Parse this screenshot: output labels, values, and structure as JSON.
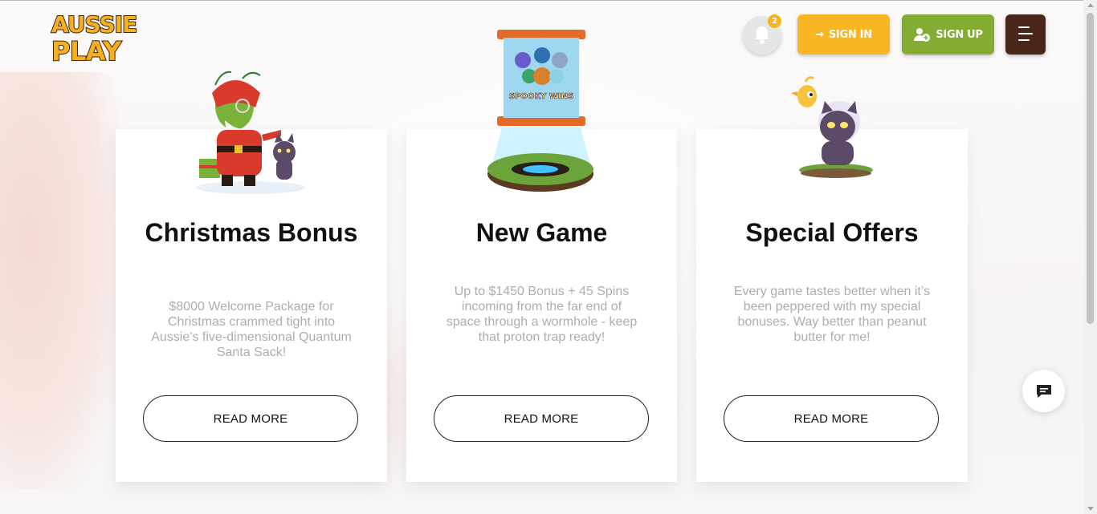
{
  "brand": {
    "logo_line1": "AUSSIE",
    "logo_line2": "PLAY"
  },
  "header": {
    "notifications_count": "2",
    "signin_label": "SIGN IN",
    "signup_label": "SIGN UP",
    "bell_icon": "bell-icon",
    "menu_icon": "hamburger-menu-icon"
  },
  "cards": [
    {
      "title": "Christmas Bonus",
      "text": "$8000 Welcome Package for Christmas crammed tight into Aussie’s five-dimensional Quantum Santa Sack!",
      "button": "READ MORE"
    },
    {
      "title": "New Game",
      "text": "Up to $1450 Bonus + 45 Spins incoming from the far end of space through a wormhole - keep that proton trap ready!",
      "button": "READ MORE",
      "game_logo": "SPOOKY WINS"
    },
    {
      "title": "Special Offers",
      "text": "Every game tastes better when it’s been peppered with my special bonuses. Way better than peanut butter for me!",
      "button": "READ MORE"
    }
  ],
  "colors": {
    "signin": "#f8b722",
    "signup": "#84ac33",
    "menu": "#4a2519",
    "badge": "#f6b523"
  },
  "chat_icon": "chat-icon"
}
